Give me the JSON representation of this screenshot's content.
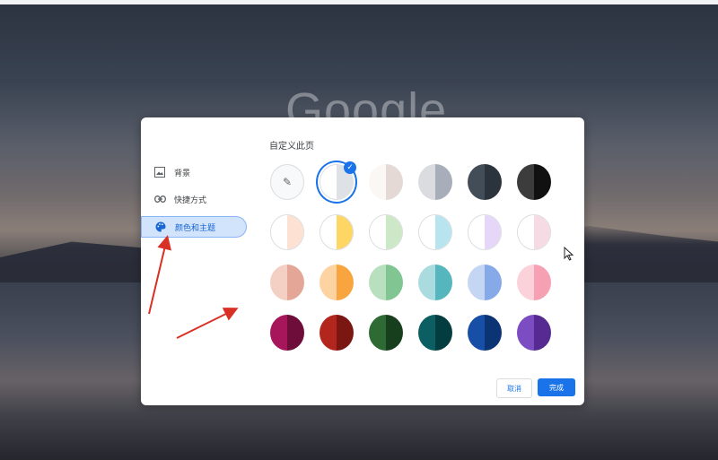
{
  "background": {
    "logo_text": "Google"
  },
  "dialog": {
    "title": "自定义此页",
    "nav": [
      {
        "label": "背景",
        "icon": "image-icon"
      },
      {
        "label": "快捷方式",
        "icon": "link-icon"
      },
      {
        "label": "颜色和主题",
        "icon": "palette-icon",
        "active": true
      }
    ],
    "swatch_rows": [
      [
        {
          "name": "custom-color",
          "left": "#f8f9fa",
          "right": "#f8f9fa",
          "icon": "pencil-icon"
        },
        {
          "name": "default",
          "left": "#ffffff",
          "right": "#dee1e6",
          "selected": true
        },
        {
          "name": "warm-grey",
          "left": "#faf7f5",
          "right": "#e4d9d5"
        },
        {
          "name": "cool-grey",
          "left": "#dadce0",
          "right": "#a8adba"
        },
        {
          "name": "slate",
          "left": "#434d58",
          "right": "#2b333c"
        },
        {
          "name": "black",
          "left": "#3c3c3c",
          "right": "#111111"
        }
      ],
      [
        {
          "name": "beige-white",
          "left": "#ffffff",
          "right": "#fde2d3"
        },
        {
          "name": "yellow-white",
          "left": "#ffffff",
          "right": "#fdd663"
        },
        {
          "name": "green-white",
          "left": "#ffffff",
          "right": "#cde8c7"
        },
        {
          "name": "cyan-white",
          "left": "#ffffff",
          "right": "#b7e4ee"
        },
        {
          "name": "lavender-white",
          "left": "#ffffff",
          "right": "#e6d7f8"
        },
        {
          "name": "pink-white",
          "left": "#ffffff",
          "right": "#f6dbe4"
        }
      ],
      [
        {
          "name": "peach",
          "left": "#f4d0c4",
          "right": "#e4a797"
        },
        {
          "name": "orange",
          "left": "#fdd3a2",
          "right": "#f9a53f"
        },
        {
          "name": "green",
          "left": "#b9e0be",
          "right": "#81c592"
        },
        {
          "name": "teal",
          "left": "#aadcdf",
          "right": "#56b6bd"
        },
        {
          "name": "blue",
          "left": "#c4d6f3",
          "right": "#86a9e8"
        },
        {
          "name": "pink",
          "left": "#fbd1da",
          "right": "#f5a1b3"
        }
      ],
      [
        {
          "name": "magenta",
          "left": "#a7155a",
          "right": "#6e0c3a"
        },
        {
          "name": "red",
          "left": "#b3261e",
          "right": "#7a1712"
        },
        {
          "name": "dark-green",
          "left": "#2e6b34",
          "right": "#173f1d"
        },
        {
          "name": "dark-teal",
          "left": "#0b5e62",
          "right": "#043d40"
        },
        {
          "name": "dark-blue",
          "left": "#174ea6",
          "right": "#0b3475"
        },
        {
          "name": "purple",
          "left": "#7c4cc2",
          "right": "#552a91"
        }
      ]
    ],
    "cancel_label": "取消",
    "done_label": "完成"
  },
  "colors": {
    "accent": "#1a73e8",
    "annotation_arrow": "#d93025"
  }
}
